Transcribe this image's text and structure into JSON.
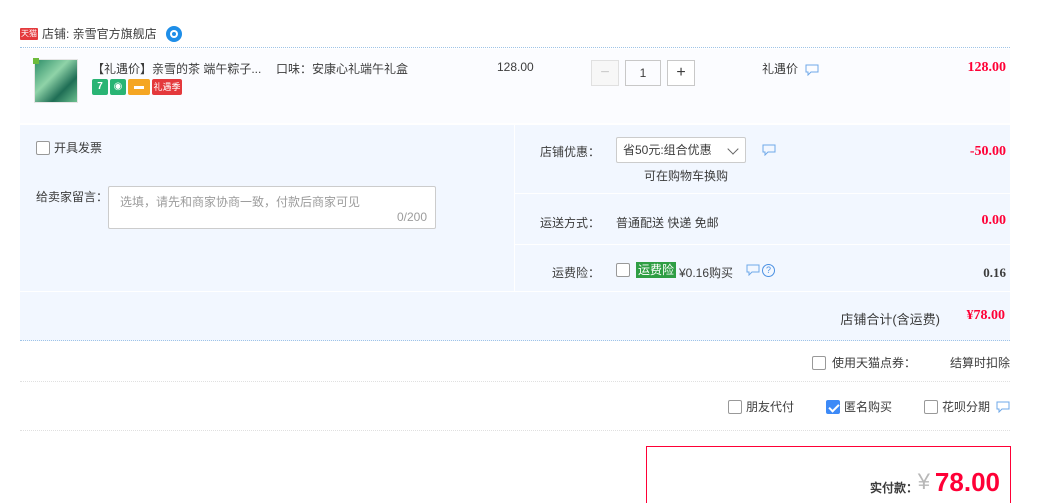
{
  "shop": {
    "badge": "天猫",
    "label": "店铺: 亲雪官方旗舰店",
    "ww_icon": "wangwang-chat-icon"
  },
  "item": {
    "title": "【礼遇价】亲雪的茶 端午粽子...",
    "sku": "口味：安康心礼端午礼盒",
    "unit_price": "128.00",
    "quantity": "1",
    "qty_minus": "−",
    "qty_plus": "+",
    "gift_price_label": "礼遇价",
    "total": "128.00",
    "icons": {
      "seven": "7",
      "gift_label": "礼遇季"
    }
  },
  "options": {
    "invoice_label": "开具发票",
    "message_label": "给卖家留言：",
    "message_placeholder": "选填，请先和商家协商一致，付款后商家可见",
    "message_count": "0/200",
    "coupon_label": "店铺优惠：",
    "coupon_selected": "省50元:组合优惠",
    "coupon_note": "可在购物车换购",
    "discount": "-50.00",
    "shipping_label": "运送方式：",
    "shipping_value": "普通配送 快递 免邮",
    "shipping_amount": "0.00",
    "insurance_label": "运费险：",
    "insurance_tag": "运费险",
    "insurance_value": "¥0.16购买",
    "insurance_amount": "0.16"
  },
  "shop_total": {
    "label": "店铺合计(含运费)",
    "value": "¥78.00"
  },
  "points": {
    "label": "使用天猫点券：",
    "note": "结算时扣除"
  },
  "pay_options": {
    "friend_pay": "朋友代付",
    "anonymous": "匿名购买",
    "huabei": "花呗分期"
  },
  "actual_pay": {
    "label": "实付款：",
    "currency": "¥",
    "amount": "78.00"
  },
  "colors": {
    "accent_red": "#ff0036",
    "panel_bg": "#f2f7ff",
    "checkbox_checked": "#3d8af7",
    "insurance_tag": "#2f9e44"
  }
}
